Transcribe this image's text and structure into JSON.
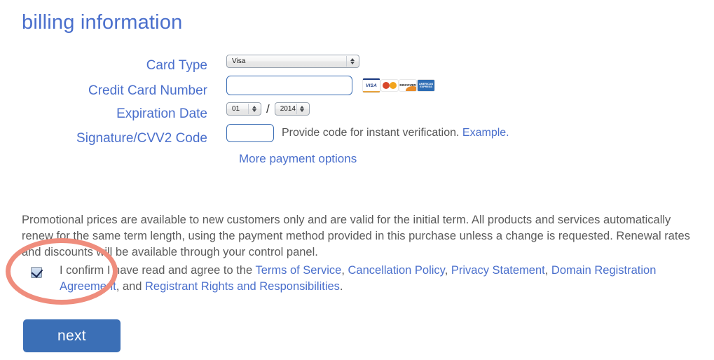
{
  "page": {
    "title": "billing information"
  },
  "form": {
    "card_type": {
      "label": "Card Type",
      "value": "Visa"
    },
    "credit_card_number": {
      "label": "Credit Card Number",
      "value": "",
      "placeholder": ""
    },
    "expiration_date": {
      "label": "Expiration Date",
      "month": "01",
      "separator": "/",
      "year": "2014"
    },
    "cvv2": {
      "label": "Signature/CVV2 Code",
      "value": "",
      "placeholder": "",
      "hint": "Provide code for instant verification.",
      "hint_link": "Example."
    },
    "more_payment_options": "More payment options",
    "card_logos": [
      {
        "name": "visa-logo",
        "text": "VISA"
      },
      {
        "name": "mastercard-logo",
        "text": ""
      },
      {
        "name": "discover-logo",
        "text": "DISCOVER"
      },
      {
        "name": "amex-logo",
        "line1": "AMERICAN",
        "line2": "EXPRESS"
      }
    ]
  },
  "promo": {
    "text": "Promotional prices are available to new customers only and are valid for the initial term. All products and services automatically renew for the same term length, using the payment method provided in this purchase unless a change is requested. Renewal rates and discounts will be available through your control panel."
  },
  "confirm": {
    "checked": true,
    "lead": "I confirm I have read and agree to the ",
    "links": [
      "Terms of Service",
      "Cancellation Policy",
      "Privacy Statement",
      "Domain Registration Agreement",
      "Registrant Rights and Responsibilities"
    ],
    "separator": ", ",
    "conjunction": " and ",
    "terminator": "."
  },
  "actions": {
    "next_label": "next"
  },
  "colors": {
    "accent_blue": "#4a6fcc",
    "button_blue": "#3b6fb6",
    "annotation_salmon": "#ef8d7d",
    "body_text": "#5b5b5b"
  }
}
